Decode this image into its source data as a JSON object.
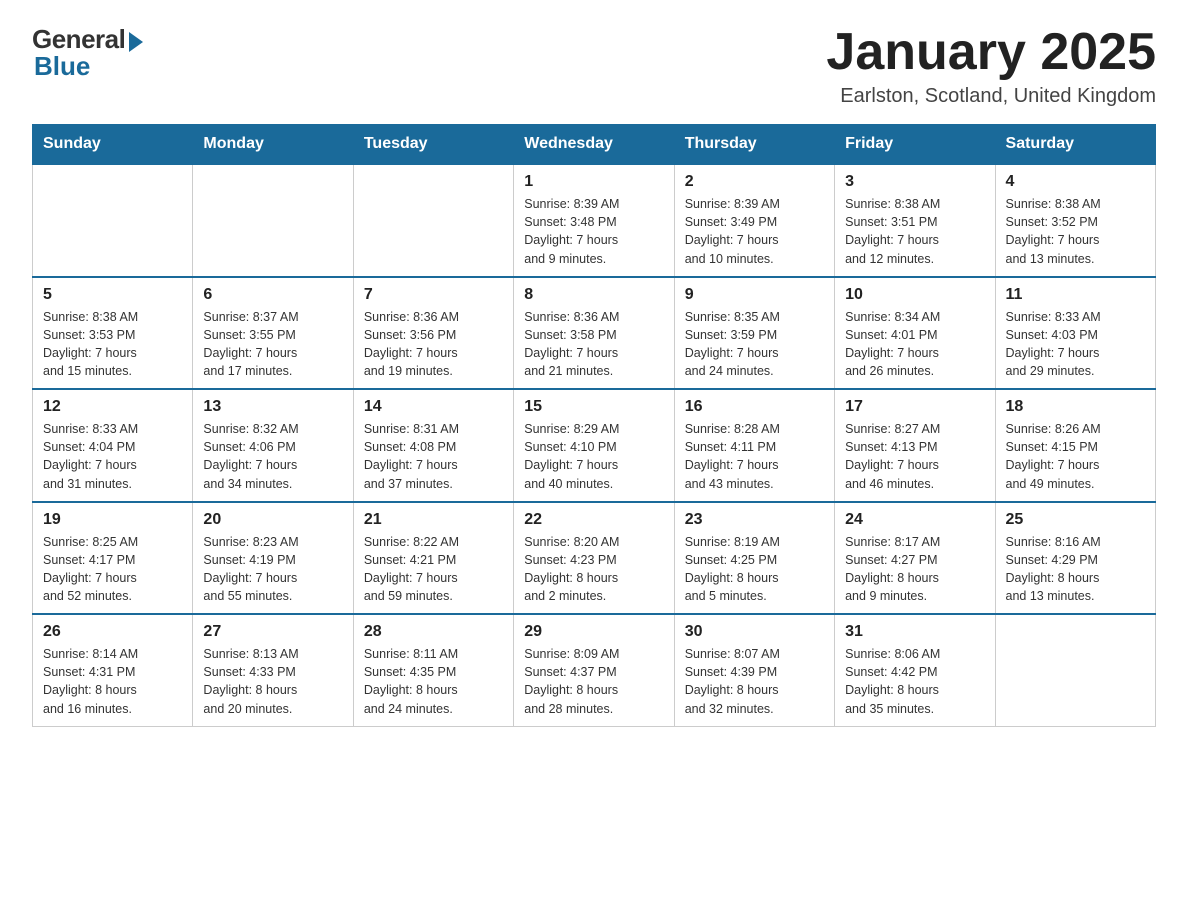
{
  "header": {
    "logo_general": "General",
    "logo_blue": "Blue",
    "month_title": "January 2025",
    "location": "Earlston, Scotland, United Kingdom"
  },
  "days_of_week": [
    "Sunday",
    "Monday",
    "Tuesday",
    "Wednesday",
    "Thursday",
    "Friday",
    "Saturday"
  ],
  "weeks": [
    [
      {
        "day": "",
        "info": ""
      },
      {
        "day": "",
        "info": ""
      },
      {
        "day": "",
        "info": ""
      },
      {
        "day": "1",
        "info": "Sunrise: 8:39 AM\nSunset: 3:48 PM\nDaylight: 7 hours\nand 9 minutes."
      },
      {
        "day": "2",
        "info": "Sunrise: 8:39 AM\nSunset: 3:49 PM\nDaylight: 7 hours\nand 10 minutes."
      },
      {
        "day": "3",
        "info": "Sunrise: 8:38 AM\nSunset: 3:51 PM\nDaylight: 7 hours\nand 12 minutes."
      },
      {
        "day": "4",
        "info": "Sunrise: 8:38 AM\nSunset: 3:52 PM\nDaylight: 7 hours\nand 13 minutes."
      }
    ],
    [
      {
        "day": "5",
        "info": "Sunrise: 8:38 AM\nSunset: 3:53 PM\nDaylight: 7 hours\nand 15 minutes."
      },
      {
        "day": "6",
        "info": "Sunrise: 8:37 AM\nSunset: 3:55 PM\nDaylight: 7 hours\nand 17 minutes."
      },
      {
        "day": "7",
        "info": "Sunrise: 8:36 AM\nSunset: 3:56 PM\nDaylight: 7 hours\nand 19 minutes."
      },
      {
        "day": "8",
        "info": "Sunrise: 8:36 AM\nSunset: 3:58 PM\nDaylight: 7 hours\nand 21 minutes."
      },
      {
        "day": "9",
        "info": "Sunrise: 8:35 AM\nSunset: 3:59 PM\nDaylight: 7 hours\nand 24 minutes."
      },
      {
        "day": "10",
        "info": "Sunrise: 8:34 AM\nSunset: 4:01 PM\nDaylight: 7 hours\nand 26 minutes."
      },
      {
        "day": "11",
        "info": "Sunrise: 8:33 AM\nSunset: 4:03 PM\nDaylight: 7 hours\nand 29 minutes."
      }
    ],
    [
      {
        "day": "12",
        "info": "Sunrise: 8:33 AM\nSunset: 4:04 PM\nDaylight: 7 hours\nand 31 minutes."
      },
      {
        "day": "13",
        "info": "Sunrise: 8:32 AM\nSunset: 4:06 PM\nDaylight: 7 hours\nand 34 minutes."
      },
      {
        "day": "14",
        "info": "Sunrise: 8:31 AM\nSunset: 4:08 PM\nDaylight: 7 hours\nand 37 minutes."
      },
      {
        "day": "15",
        "info": "Sunrise: 8:29 AM\nSunset: 4:10 PM\nDaylight: 7 hours\nand 40 minutes."
      },
      {
        "day": "16",
        "info": "Sunrise: 8:28 AM\nSunset: 4:11 PM\nDaylight: 7 hours\nand 43 minutes."
      },
      {
        "day": "17",
        "info": "Sunrise: 8:27 AM\nSunset: 4:13 PM\nDaylight: 7 hours\nand 46 minutes."
      },
      {
        "day": "18",
        "info": "Sunrise: 8:26 AM\nSunset: 4:15 PM\nDaylight: 7 hours\nand 49 minutes."
      }
    ],
    [
      {
        "day": "19",
        "info": "Sunrise: 8:25 AM\nSunset: 4:17 PM\nDaylight: 7 hours\nand 52 minutes."
      },
      {
        "day": "20",
        "info": "Sunrise: 8:23 AM\nSunset: 4:19 PM\nDaylight: 7 hours\nand 55 minutes."
      },
      {
        "day": "21",
        "info": "Sunrise: 8:22 AM\nSunset: 4:21 PM\nDaylight: 7 hours\nand 59 minutes."
      },
      {
        "day": "22",
        "info": "Sunrise: 8:20 AM\nSunset: 4:23 PM\nDaylight: 8 hours\nand 2 minutes."
      },
      {
        "day": "23",
        "info": "Sunrise: 8:19 AM\nSunset: 4:25 PM\nDaylight: 8 hours\nand 5 minutes."
      },
      {
        "day": "24",
        "info": "Sunrise: 8:17 AM\nSunset: 4:27 PM\nDaylight: 8 hours\nand 9 minutes."
      },
      {
        "day": "25",
        "info": "Sunrise: 8:16 AM\nSunset: 4:29 PM\nDaylight: 8 hours\nand 13 minutes."
      }
    ],
    [
      {
        "day": "26",
        "info": "Sunrise: 8:14 AM\nSunset: 4:31 PM\nDaylight: 8 hours\nand 16 minutes."
      },
      {
        "day": "27",
        "info": "Sunrise: 8:13 AM\nSunset: 4:33 PM\nDaylight: 8 hours\nand 20 minutes."
      },
      {
        "day": "28",
        "info": "Sunrise: 8:11 AM\nSunset: 4:35 PM\nDaylight: 8 hours\nand 24 minutes."
      },
      {
        "day": "29",
        "info": "Sunrise: 8:09 AM\nSunset: 4:37 PM\nDaylight: 8 hours\nand 28 minutes."
      },
      {
        "day": "30",
        "info": "Sunrise: 8:07 AM\nSunset: 4:39 PM\nDaylight: 8 hours\nand 32 minutes."
      },
      {
        "day": "31",
        "info": "Sunrise: 8:06 AM\nSunset: 4:42 PM\nDaylight: 8 hours\nand 35 minutes."
      },
      {
        "day": "",
        "info": ""
      }
    ]
  ]
}
